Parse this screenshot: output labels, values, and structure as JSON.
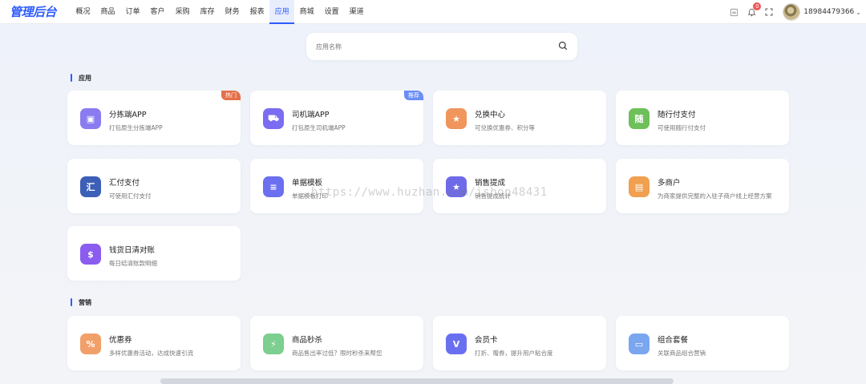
{
  "app": {
    "logo": "管理后台"
  },
  "nav": [
    {
      "label": "概况"
    },
    {
      "label": "商品"
    },
    {
      "label": "订单"
    },
    {
      "label": "客户"
    },
    {
      "label": "采购"
    },
    {
      "label": "库存"
    },
    {
      "label": "财务"
    },
    {
      "label": "报表"
    },
    {
      "label": "应用",
      "active": true
    },
    {
      "label": "商城"
    },
    {
      "label": "设置"
    },
    {
      "label": "渠道"
    }
  ],
  "header": {
    "notification_count": "0",
    "username": "18984479366",
    "caret": "⌄"
  },
  "search": {
    "placeholder": "应用名称"
  },
  "sections": {
    "apps": {
      "title": "应用"
    },
    "marketing": {
      "title": "营销"
    }
  },
  "apps": [
    {
      "title": "分拣端APP",
      "desc": "打包原生分拣端APP",
      "tag": "热门",
      "tag_type": "hot",
      "icon": "box-icon",
      "color": "#8a7cf0",
      "glyph": "▣"
    },
    {
      "title": "司机端APP",
      "desc": "打包原生司机端APP",
      "tag": "推荐",
      "tag_type": "rec",
      "icon": "truck-icon",
      "color": "#7b6cf2",
      "glyph": "⛟"
    },
    {
      "title": "兑换中心",
      "desc": "可兑换优惠券、积分等",
      "icon": "exchange-icon",
      "color": "#f0955c",
      "glyph": "★"
    },
    {
      "title": "随行付支付",
      "desc": "可使用随行付支付",
      "icon": "vbill-icon",
      "color": "#6fbf5a",
      "glyph": "随"
    },
    {
      "title": "汇付支付",
      "desc": "可使用汇付支付",
      "icon": "huifu-icon",
      "color": "#3c5fb8",
      "glyph": "汇"
    },
    {
      "title": "单据模板",
      "desc": "单据模板打印",
      "icon": "template-icon",
      "color": "#6b6ff0",
      "glyph": "≡"
    },
    {
      "title": "销售提成",
      "desc": "销售提成统计",
      "icon": "commission-icon",
      "color": "#6f6be8",
      "glyph": "★"
    },
    {
      "title": "多商户",
      "desc": "为商家提供完整的入驻子商户线上经营方案",
      "icon": "store-icon",
      "color": "#f0a050",
      "glyph": "▤"
    },
    {
      "title": "钱货日清对账",
      "desc": "每日结清账款明细",
      "icon": "dollar-icon",
      "color": "#8a5cf0",
      "glyph": "$"
    }
  ],
  "marketing": [
    {
      "title": "优惠券",
      "desc": "多样优惠券活动，达成快速引流",
      "icon": "coupon-icon",
      "color": "#f2a06a",
      "glyph": "%"
    },
    {
      "title": "商品秒杀",
      "desc": "商品售出率过低？限时秒杀来帮您",
      "icon": "flash-sale-icon",
      "color": "#7ccf8e",
      "glyph": "⚡"
    },
    {
      "title": "会员卡",
      "desc": "打折、赠券，提升用户粘合度",
      "icon": "member-card-icon",
      "color": "#6a6ff0",
      "glyph": "V"
    },
    {
      "title": "组合套餐",
      "desc": "关联商品组合营销",
      "icon": "bundle-icon",
      "color": "#7aa6f0",
      "glyph": "▭"
    }
  ],
  "watermark": "https://www.huzhan.com/ishop48431"
}
